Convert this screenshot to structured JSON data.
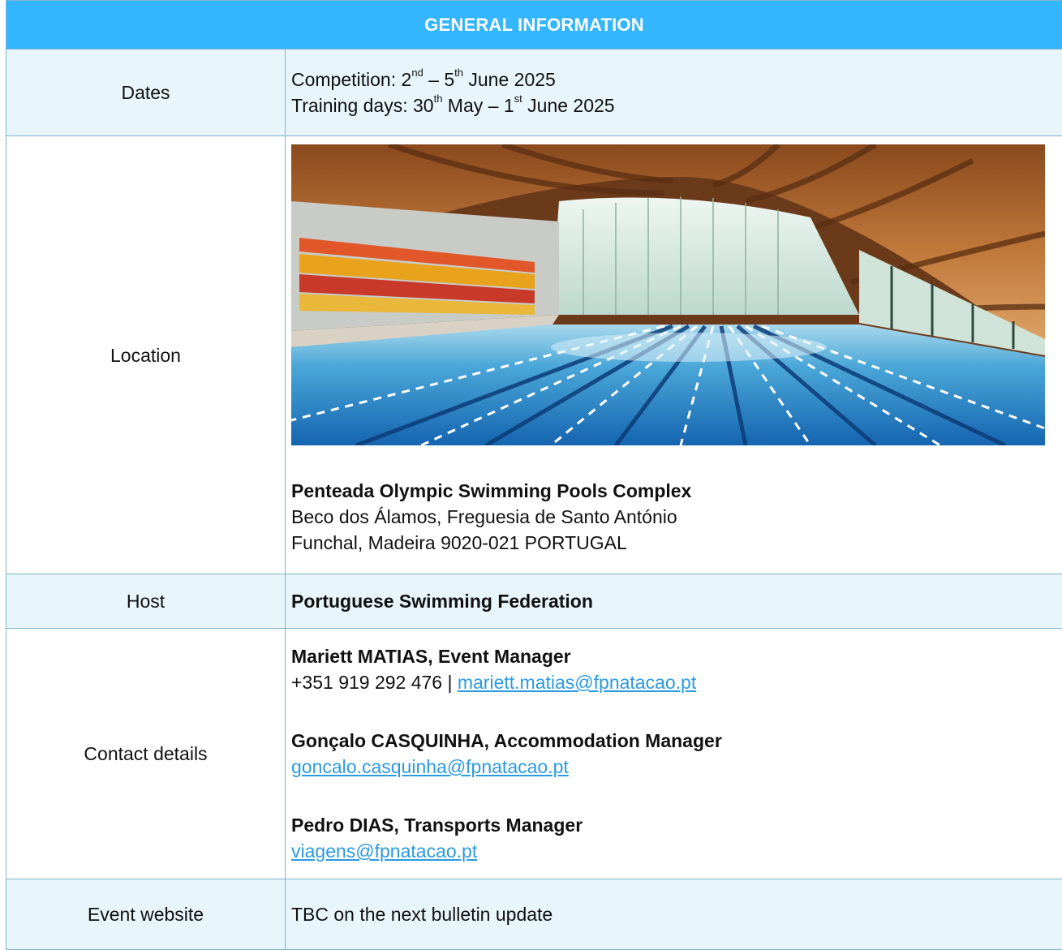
{
  "header": {
    "title": "GENERAL INFORMATION"
  },
  "dates": {
    "label": "Dates",
    "competition_prefix": "Competition: 2",
    "competition_sup1": "nd",
    "competition_mid": " – 5",
    "competition_sup2": "th",
    "competition_suffix": " June 2025",
    "training_prefix": "Training days: 30",
    "training_sup1": "th",
    "training_mid": " May – 1",
    "training_sup2": "st",
    "training_suffix": " June 2025"
  },
  "location": {
    "label": "Location",
    "venue_name": "Penteada Olympic Swimming Pools Complex",
    "address_line1": "Beco dos Álamos, Freguesia de Santo António",
    "address_line2": "Funchal, Madeira 9020-021 PORTUGAL"
  },
  "host": {
    "label": "Host",
    "value": "Portuguese Swimming Federation"
  },
  "contact": {
    "label": "Contact details",
    "people": [
      {
        "name": "Mariett MATIAS, Event Manager",
        "phone": "+351 919 292 476 | ",
        "email": "mariett.matias@fpnatacao.pt"
      },
      {
        "name": "Gonçalo CASQUINHA, Accommodation Manager",
        "email": "goncalo.casquinha@fpnatacao.pt"
      },
      {
        "name": "Pedro DIAS, Transports Manager",
        "email": "viagens@fpnatacao.pt"
      }
    ]
  },
  "website": {
    "label": "Event website",
    "value": "TBC on the next bulletin update"
  },
  "colors": {
    "header_bg": "#33b5ff",
    "row_shade": "#e8f5fb",
    "border": "#7db3cf",
    "link": "#2b9be0"
  }
}
